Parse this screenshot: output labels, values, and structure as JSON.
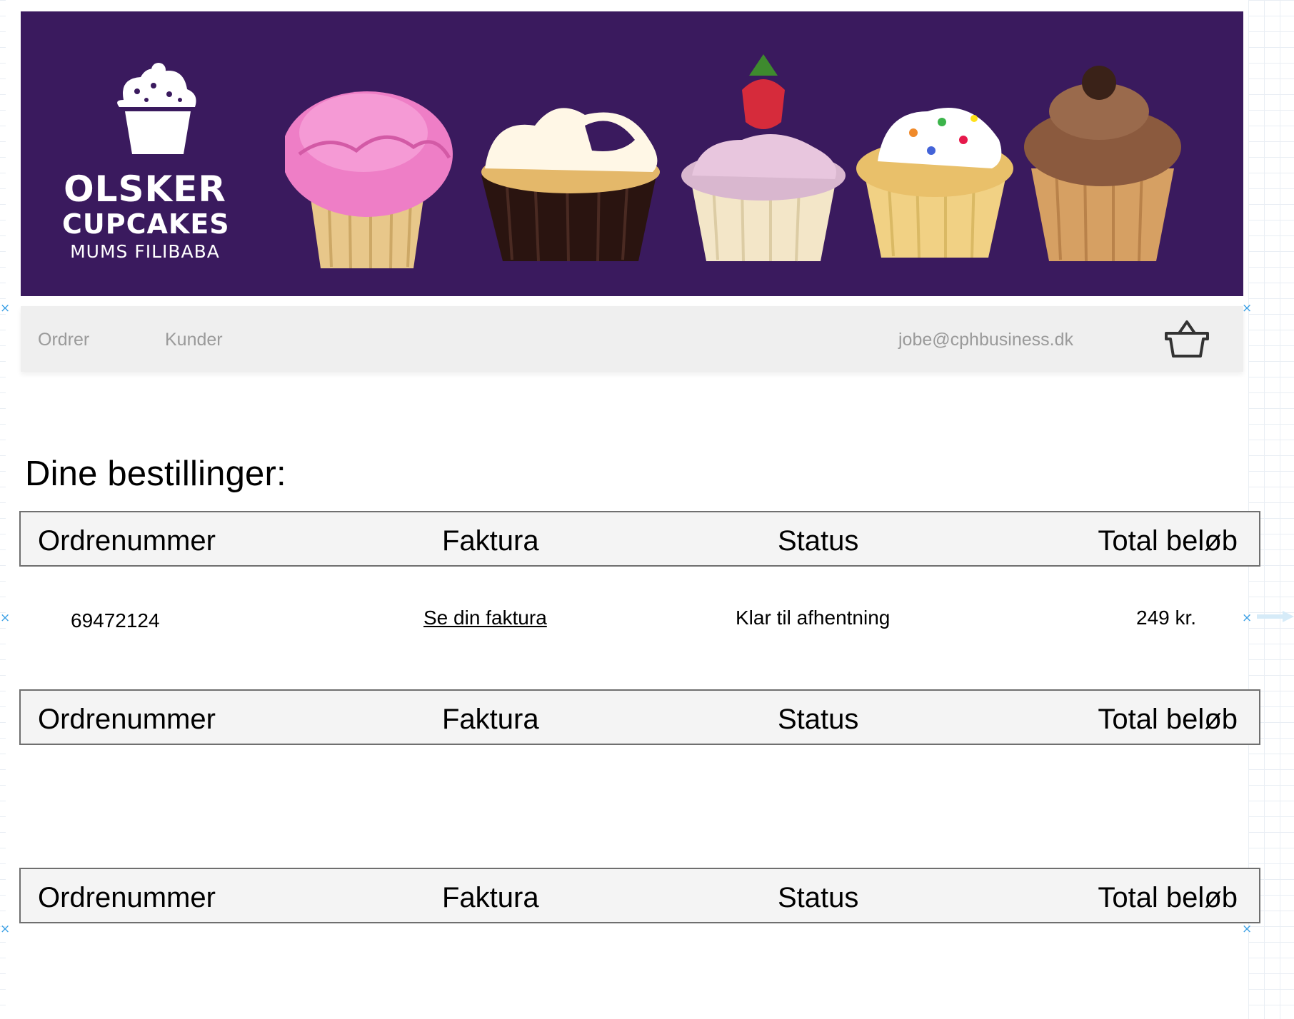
{
  "banner": {
    "brand_line1": "OLSKER",
    "brand_line2": "CUPCAKES",
    "brand_line3": "MUMS FILIBABA",
    "background_color": "#3a1a5e"
  },
  "nav": {
    "orders_label": "Ordrer",
    "customers_label": "Kunder",
    "user_email": "jobe@cphbusiness.dk",
    "cart_icon": "basket-icon"
  },
  "page": {
    "heading": "Dine bestillinger:"
  },
  "table": {
    "columns": [
      "Ordrenummer",
      "Faktura",
      "Status",
      "Total beløb"
    ],
    "orders": [
      {
        "order_number": "69472124",
        "invoice_link": "Se din faktura",
        "status": "Klar til afhentning",
        "total": "249 kr."
      }
    ]
  },
  "markers": {
    "symbol": "×"
  }
}
